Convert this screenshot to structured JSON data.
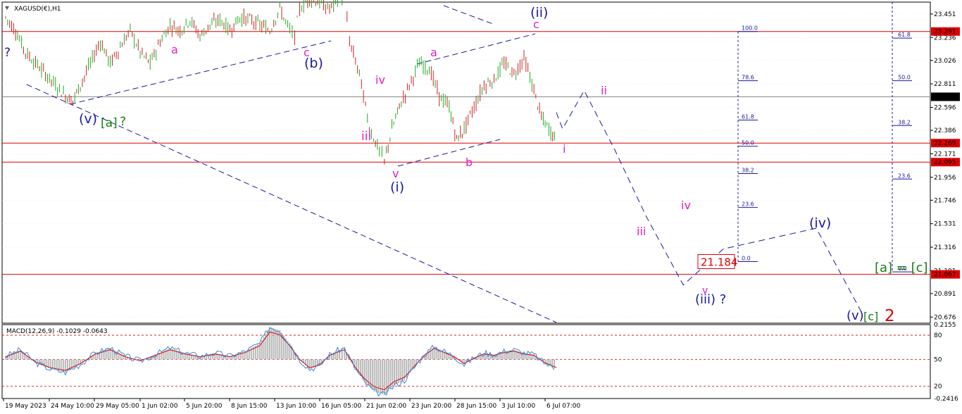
{
  "chart_data": {
    "type": "line",
    "title": "XAGUSD(€),H1",
    "symbol": "XAGUSD(€)",
    "timeframe": "H1",
    "x_tick_labels": [
      "19 May 2023",
      "24 May 10:00",
      "29 May 05:00",
      "1 Jun 02:00",
      "5 Jun 20:00",
      "8 Jun 15:00",
      "13 Jun 10:00",
      "16 Jun 05:00",
      "21 Jun 02:00",
      "23 Jun 20:00",
      "28 Jun 15:00",
      "3 Jul 10:00",
      "6 Jul 07:00"
    ],
    "price_axis": {
      "ylim": [
        20.62,
        23.56
      ],
      "tick_labels": [
        "23.451",
        "23.236",
        "23.026",
        "22.811",
        "22.596",
        "22.386",
        "22.171",
        "21.956",
        "21.746",
        "21.531",
        "21.316",
        "21.101",
        "20.891",
        "20.676"
      ],
      "tick_values": [
        23.451,
        23.236,
        23.026,
        22.811,
        22.596,
        22.386,
        22.171,
        21.956,
        21.746,
        21.531,
        21.316,
        21.101,
        20.891,
        20.676
      ]
    },
    "price_path": [
      [
        0,
        23.42
      ],
      [
        4,
        23.3
      ],
      [
        8,
        23.1
      ],
      [
        12,
        23.0
      ],
      [
        16,
        22.9
      ],
      [
        20,
        22.8
      ],
      [
        24,
        22.7
      ],
      [
        27,
        22.66
      ],
      [
        30,
        22.8
      ],
      [
        34,
        23.0
      ],
      [
        38,
        23.2
      ],
      [
        42,
        23.0
      ],
      [
        46,
        23.15
      ],
      [
        50,
        23.3
      ],
      [
        54,
        23.1
      ],
      [
        58,
        23.0
      ],
      [
        62,
        23.2
      ],
      [
        66,
        23.35
      ],
      [
        70,
        23.3
      ],
      [
        74,
        23.4
      ],
      [
        78,
        23.25
      ],
      [
        82,
        23.35
      ],
      [
        86,
        23.4
      ],
      [
        90,
        23.3
      ],
      [
        94,
        23.42
      ],
      [
        98,
        23.4
      ],
      [
        102,
        23.35
      ],
      [
        106,
        23.3
      ],
      [
        110,
        23.5
      ],
      [
        114,
        23.3
      ],
      [
        116,
        23.25
      ],
      [
        118,
        23.5
      ],
      [
        122,
        23.6
      ],
      [
        126,
        23.55
      ],
      [
        130,
        23.5
      ],
      [
        134,
        23.6
      ],
      [
        136,
        23.6
      ],
      [
        138,
        23.2
      ],
      [
        142,
        22.9
      ],
      [
        146,
        22.4
      ],
      [
        150,
        22.2
      ],
      [
        152,
        22.1
      ],
      [
        155,
        22.4
      ],
      [
        158,
        22.6
      ],
      [
        162,
        22.8
      ],
      [
        166,
        23.0
      ],
      [
        170,
        22.95
      ],
      [
        174,
        22.7
      ],
      [
        178,
        22.6
      ],
      [
        181,
        22.3
      ],
      [
        184,
        22.4
      ],
      [
        188,
        22.6
      ],
      [
        192,
        22.8
      ],
      [
        196,
        22.85
      ],
      [
        200,
        23.0
      ],
      [
        204,
        22.9
      ],
      [
        208,
        23.05
      ],
      [
        212,
        22.75
      ],
      [
        215,
        22.5
      ],
      [
        218,
        22.4
      ],
      [
        221,
        22.3
      ]
    ],
    "price_path_x_range": [
      0,
      221
    ],
    "horizontal_levels": [
      {
        "label": "23.291",
        "value": 23.291,
        "color": "#dd0000"
      },
      {
        "label": "22.693",
        "value": 22.693,
        "color": "#888888"
      },
      {
        "label": "22.269",
        "value": 22.269,
        "color": "#dd0000"
      },
      {
        "label": "22.095",
        "value": 22.095,
        "color": "#dd0000"
      },
      {
        "label": "21.067",
        "value": 21.067,
        "color": "#dd0000"
      }
    ],
    "current_price": {
      "label": "22.693",
      "value": 22.693
    },
    "target_box": {
      "label": "21.184",
      "value": 21.184
    },
    "fibonacci_left": [
      {
        "label": "100.0",
        "value": 23.291
      },
      {
        "label": "78.6",
        "value": 22.84
      },
      {
        "label": "61.8",
        "value": 22.48
      },
      {
        "label": "50.0",
        "value": 22.24
      },
      {
        "label": "38.2",
        "value": 21.99
      },
      {
        "label": "23.6",
        "value": 21.68
      },
      {
        "label": "0.0",
        "value": 21.184
      }
    ],
    "fibonacci_right": [
      {
        "label": "61.8",
        "value": 23.23
      },
      {
        "label": "50.0",
        "value": 22.84
      },
      {
        "label": "38.2",
        "value": 22.43
      },
      {
        "label": "23.6",
        "value": 21.94
      },
      {
        "label": "0.0",
        "value": 21.09
      }
    ],
    "wave_labels": [
      {
        "text": "?",
        "color": "#1a1aa0"
      },
      {
        "text": "a",
        "color": "#e020c0"
      },
      {
        "text": "c",
        "color": "#e020c0"
      },
      {
        "text": "(b)",
        "color": "#1a1aa0"
      },
      {
        "text": "(v)",
        "color": "#1a1aa0"
      },
      {
        "text": "[a]",
        "color": "#1a7a1a"
      },
      {
        "text": "?",
        "color": "#1a7a1a"
      },
      {
        "text": "iv",
        "color": "#e020c0"
      },
      {
        "text": "iii",
        "color": "#e020c0"
      },
      {
        "text": "v",
        "color": "#e020c0"
      },
      {
        "text": "(i)",
        "color": "#1a1aa0"
      },
      {
        "text": "a",
        "color": "#e020c0"
      },
      {
        "text": "b",
        "color": "#e020c0"
      },
      {
        "text": "(ii)",
        "color": "#1a1aa0"
      },
      {
        "text": "c",
        "color": "#e020c0"
      },
      {
        "text": "ii",
        "color": "#e020c0"
      },
      {
        "text": "i",
        "color": "#e020c0"
      },
      {
        "text": "iv",
        "color": "#e020c0"
      },
      {
        "text": "iii",
        "color": "#e020c0"
      },
      {
        "text": "v",
        "color": "#e020c0"
      },
      {
        "text": "(iii) ?",
        "color": "#1a1aa0"
      },
      {
        "text": "(iv)",
        "color": "#1a1aa0"
      },
      {
        "text": "(v)",
        "color": "#1a1aa0"
      },
      {
        "text": "[c]",
        "color": "#1a7a1a"
      },
      {
        "text": "2",
        "color": "#dd0000"
      },
      {
        "text": "[a] = [c]",
        "color": "#1a7a1a"
      }
    ],
    "projection": [
      [
        221,
        22.55
      ],
      [
        223,
        22.4
      ],
      [
        230,
        22.75
      ],
      [
        240,
        22.2
      ],
      [
        250,
        21.6
      ],
      [
        262,
        20.97
      ],
      [
        275,
        21.3
      ],
      [
        305,
        21.49
      ],
      [
        320,
        20.7
      ]
    ]
  },
  "macd": {
    "label": "MACD(12,26,9) -0.1029 -0.0643",
    "ylim": [
      -0.2416,
      0.2155
    ],
    "tick_labels": [
      "0.2155",
      "80",
      "50",
      "20",
      "-0.2416"
    ],
    "tick_values": [
      0.2155,
      0.15,
      0.0,
      -0.165,
      -0.2416
    ],
    "levels": [
      0.15,
      0.0,
      -0.165
    ],
    "histogram_path": [
      [
        0,
        0.02
      ],
      [
        6,
        0.06
      ],
      [
        12,
        -0.02
      ],
      [
        18,
        -0.06
      ],
      [
        24,
        -0.08
      ],
      [
        30,
        -0.03
      ],
      [
        36,
        0.04
      ],
      [
        42,
        0.07
      ],
      [
        48,
        0.02
      ],
      [
        54,
        -0.01
      ],
      [
        60,
        0.03
      ],
      [
        66,
        0.07
      ],
      [
        72,
        0.04
      ],
      [
        78,
        0.02
      ],
      [
        84,
        0.04
      ],
      [
        90,
        0.02
      ],
      [
        96,
        0.05
      ],
      [
        102,
        0.1
      ],
      [
        106,
        0.2
      ],
      [
        110,
        0.18
      ],
      [
        114,
        0.1
      ],
      [
        118,
        0.0
      ],
      [
        122,
        -0.06
      ],
      [
        126,
        -0.04
      ],
      [
        130,
        0.03
      ],
      [
        134,
        0.06
      ],
      [
        136,
        0.07
      ],
      [
        140,
        -0.05
      ],
      [
        144,
        -0.14
      ],
      [
        148,
        -0.2
      ],
      [
        152,
        -0.22
      ],
      [
        156,
        -0.16
      ],
      [
        160,
        -0.13
      ],
      [
        164,
        -0.05
      ],
      [
        168,
        0.03
      ],
      [
        172,
        0.08
      ],
      [
        176,
        0.05
      ],
      [
        180,
        0.02
      ],
      [
        184,
        -0.03
      ],
      [
        188,
        0.01
      ],
      [
        192,
        0.04
      ],
      [
        196,
        0.03
      ],
      [
        200,
        0.05
      ],
      [
        204,
        0.06
      ],
      [
        208,
        0.04
      ],
      [
        212,
        0.03
      ],
      [
        216,
        -0.02
      ],
      [
        221,
        -0.06
      ]
    ],
    "histogram_x_range": [
      0,
      221
    ]
  },
  "colors": {
    "candle_up": "#22aa22",
    "candle_down": "#cc2222",
    "grid": "#d9d9d9",
    "macd_hist": "#b9b9b9",
    "macd_signal": "#dd0000",
    "macd_line": "#3a8ad8",
    "dashed_blue": "#1a1aa0"
  }
}
